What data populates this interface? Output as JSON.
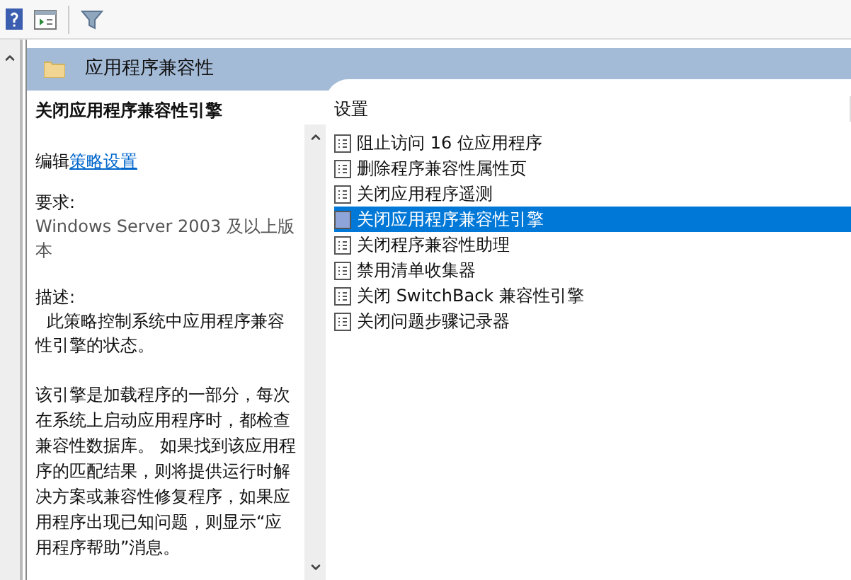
{
  "header": {
    "title": "应用程序兼容性"
  },
  "detail": {
    "heading": "关闭应用程序兼容性引擎",
    "edit_prefix": "编辑",
    "edit_link": "策略设置",
    "requirements_label": "要求:",
    "requirements": "Windows Server 2003 及以上版本",
    "description_label": "描述:",
    "description": "此策略控制系统中应用程序兼容性引擎的状态。",
    "body": "该引擎是加载程序的一部分，每次在系统上启动应用程序时，都检查兼容性数据库。 如果找到该应用程序的匹配结果，则将提供运行时解决方案或兼容性修复程序，如果应用程序出现已知问题，则显示“应用程序帮助”消息。"
  },
  "settings": {
    "column": "设置",
    "items": [
      {
        "label": "阻止访问 16 位应用程序",
        "selected": false
      },
      {
        "label": "删除程序兼容性属性页",
        "selected": false
      },
      {
        "label": "关闭应用程序遥测",
        "selected": false
      },
      {
        "label": "关闭应用程序兼容性引擎",
        "selected": true
      },
      {
        "label": "关闭程序兼容性助理",
        "selected": false
      },
      {
        "label": "禁用清单收集器",
        "selected": false
      },
      {
        "label": "关闭 SwitchBack 兼容性引擎",
        "selected": false
      },
      {
        "label": "关闭问题步骤记录器",
        "selected": false
      }
    ]
  }
}
